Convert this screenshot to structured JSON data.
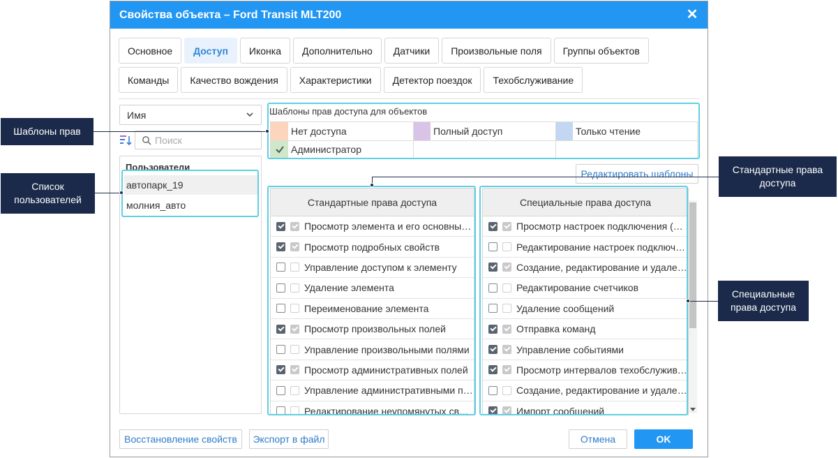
{
  "dialog": {
    "title": "Свойства объекта – Ford Transit MLT200",
    "close_icon": "close-icon"
  },
  "tabs": {
    "row1": [
      "Основное",
      "Доступ",
      "Иконка",
      "Дополнительно",
      "Датчики",
      "Произвольные поля",
      "Группы объектов"
    ],
    "row2": [
      "Команды",
      "Качество вождения",
      "Характеристики",
      "Детектор поездок",
      "Техобслуживание"
    ],
    "active": "Доступ"
  },
  "left": {
    "sort_value": "Имя",
    "search_placeholder": "Поиск",
    "users_header": "Пользователи",
    "users": [
      "автопарк_19",
      "молния_авто"
    ]
  },
  "templates": {
    "title": "Шаблоны прав доступа для объектов",
    "items": [
      {
        "label": "Нет доступа",
        "color": "#fdd5bc"
      },
      {
        "label": "Полный доступ",
        "color": "#d9c3e6"
      },
      {
        "label": "Только чтение",
        "color": "#c3d7f2"
      },
      {
        "label": "Администратор",
        "color": "#cfe8c9",
        "icon": "check-icon"
      }
    ],
    "edit_button": "Редактировать шаблоны"
  },
  "standard": {
    "header": "Стандартные права доступа",
    "rows": [
      {
        "label": "Просмотр элемента и его основных свойств",
        "checked": true
      },
      {
        "label": "Просмотр подробных свойств",
        "checked": true
      },
      {
        "label": "Управление доступом к элементу",
        "checked": false
      },
      {
        "label": "Удаление элемента",
        "checked": false
      },
      {
        "label": "Переименование элемента",
        "checked": false
      },
      {
        "label": "Просмотр произвольных полей",
        "checked": true
      },
      {
        "label": "Управление произвольными полями",
        "checked": false
      },
      {
        "label": "Просмотр административных полей",
        "checked": true
      },
      {
        "label": "Управление административными полями",
        "checked": false
      },
      {
        "label": "Редактирование неупомянутых свойств",
        "checked": false
      }
    ]
  },
  "special": {
    "header": "Специальные права доступа",
    "rows": [
      {
        "label": "Просмотр настроек подключения (…",
        "checked": true
      },
      {
        "label": "Редактирование настроек подключения",
        "checked": false
      },
      {
        "label": "Создание, редактирование и удаление",
        "checked": true
      },
      {
        "label": "Редактирование счетчиков",
        "checked": false
      },
      {
        "label": "Удаление сообщений",
        "checked": false
      },
      {
        "label": "Отправка команд",
        "checked": true
      },
      {
        "label": "Управление событиями",
        "checked": true
      },
      {
        "label": "Просмотр интервалов техобслуживания",
        "checked": true
      },
      {
        "label": "Создание, редактирование и удаление",
        "checked": false
      },
      {
        "label": "Импорт сообщений",
        "checked": true
      }
    ]
  },
  "footer": {
    "restore": "Восстановление свойств",
    "export": "Экспорт в файл",
    "cancel": "Отмена",
    "ok": "OK"
  },
  "callouts": {
    "templates": "Шаблоны прав",
    "users": "Список пользователей",
    "standard": "Стандартные права доступа",
    "special": "Специальные права доступа"
  },
  "colors": {
    "accent": "#2196f3",
    "highlight": "#5fcfe3",
    "callout_bg": "#1b2a4a"
  }
}
